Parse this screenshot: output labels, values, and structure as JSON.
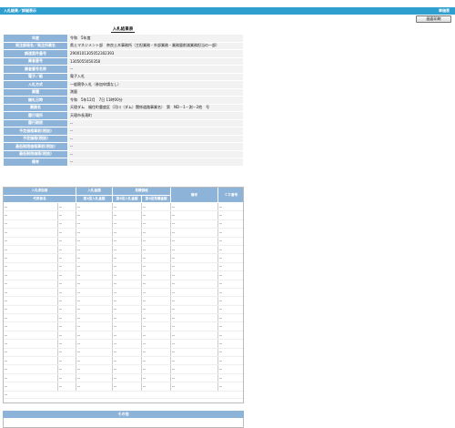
{
  "header": {
    "title": "入札結果／詳細表示",
    "user": "単価表"
  },
  "toolbar": {
    "print_label": "画面印刷"
  },
  "page_heading": "入札結果表",
  "info_rows": [
    {
      "label": "年度",
      "value": "令和　5年度"
    },
    {
      "label": "発注部局名／発注所属名",
      "value": "県土マネジメント部　奈良土木事務所（主担業務・外部業務・業務量削減業務担当の一部）"
    },
    {
      "label": "調達案件番号",
      "value": "2900101305052302393"
    },
    {
      "label": "業者番号",
      "value": "1305055050358"
    },
    {
      "label": "業者番号名称",
      "value": "--"
    },
    {
      "label": "電子／紙",
      "value": "電子入札"
    },
    {
      "label": "入札方式",
      "value": "一般競争入札（参加申請なし）"
    },
    {
      "label": "業種",
      "value": "測量"
    },
    {
      "label": "開札日時",
      "value": "令和　5年12月　7日 11時00分"
    },
    {
      "label": "業務名",
      "value": "天理ダム　福住町重度区（河川（ダム）関係道路事業名）　第　ND－1－測－2他　号"
    },
    {
      "label": "履行場所",
      "value": "天理市長滝町"
    },
    {
      "label": "履行期限",
      "value": "--"
    },
    {
      "label": "予定価格事前(税抜)",
      "value": "--"
    },
    {
      "label": "予定価格(税抜)",
      "value": "--"
    },
    {
      "label": "最低制限価格事前(税抜)",
      "value": "--"
    },
    {
      "label": "最低制限価格(税抜)",
      "value": "--"
    },
    {
      "label": "備考",
      "value": "--"
    }
  ],
  "results": {
    "group_headers": [
      "入札参加者",
      "入札金額",
      "見積価格",
      "備考",
      "ＣＤ番号"
    ],
    "sub_headers": [
      "代表者名",
      "第1回入札金額",
      "第2回入札金額",
      "第1回見積金額",
      "第2回見積金額"
    ],
    "rows": [
      [
        "--",
        "--",
        "--",
        "--",
        "--",
        "--",
        "--"
      ],
      [
        "--",
        "--",
        "--",
        "--",
        "--",
        "--",
        "--"
      ],
      [
        "--",
        "--",
        "--",
        "--",
        "--",
        "--",
        "--"
      ],
      [
        "--",
        "--",
        "--",
        "--",
        "--",
        "--",
        "--"
      ],
      [
        "--",
        "--",
        "--",
        "--",
        "--",
        "--",
        "--"
      ],
      [
        "--",
        "--",
        "--",
        "--",
        "--",
        "--",
        "--"
      ],
      [
        "--",
        "--",
        "--",
        "--",
        "--",
        "--",
        "--"
      ],
      [
        "--",
        "--",
        "--",
        "--",
        "--",
        "--",
        "--"
      ],
      [
        "--",
        "--",
        "--",
        "--",
        "--",
        "--",
        "--"
      ],
      [
        "--",
        "--",
        "--",
        "--",
        "--",
        "--",
        "--"
      ],
      [
        "--",
        "--",
        "--",
        "--",
        "--",
        "--",
        "--"
      ],
      [
        "--",
        "--",
        "--",
        "--",
        "--",
        "--",
        "--"
      ],
      [
        "--",
        "--",
        "--",
        "--",
        "--",
        "--",
        "--"
      ],
      [
        "--",
        "--",
        "--",
        "--",
        "--",
        "--",
        "--"
      ],
      [
        "--",
        "--",
        "--",
        "--",
        "--",
        "--",
        "--"
      ],
      [
        "--",
        "--",
        "--",
        "--",
        "--",
        "--",
        "--"
      ],
      [
        "--",
        "--",
        "--",
        "--",
        "--",
        "--",
        "--"
      ],
      [
        "--",
        "--",
        "--",
        "--",
        "--",
        "--",
        "--"
      ],
      [
        "--",
        "--",
        "--",
        "--",
        "--",
        "--",
        "--"
      ],
      [
        "--",
        "--",
        "--",
        "--",
        "--",
        "--",
        "--"
      ],
      [
        "--",
        "--",
        "--",
        "--",
        "--",
        "--",
        "--"
      ],
      [
        "--",
        "--",
        "--",
        "--",
        "--",
        "--",
        "--"
      ]
    ],
    "footer": "--"
  },
  "other_section": {
    "title": "その他"
  },
  "colors": {
    "topbar": "#2f9fd0",
    "label_bg": "#8db3d8",
    "value_bg": "#f2f2f2"
  }
}
